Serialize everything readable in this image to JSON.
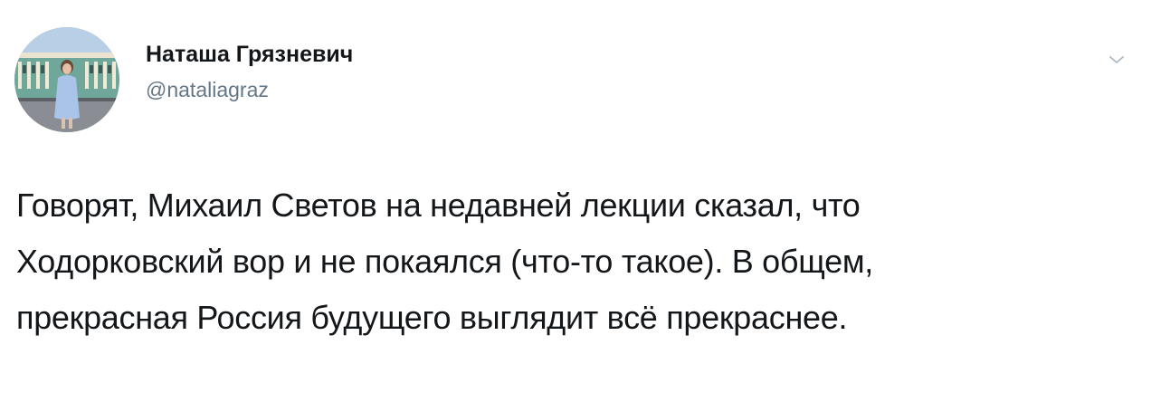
{
  "author": {
    "display_name": "Наташа Грязневич",
    "handle": "@nataliagraz",
    "avatar_icon": "profile-photo"
  },
  "menu": {
    "icon": "chevron-down-icon"
  },
  "tweet": {
    "lines": [
      "Говорят, Михаил Светов на недавней лекции сказал, что",
      "Ходорковский вор и не покаялся (что-то такое). В общем,",
      "прекрасная Россия будущего выглядит всё прекраснее."
    ]
  },
  "colors": {
    "text_primary": "#14171a",
    "text_secondary": "#657786",
    "background": "#ffffff"
  }
}
